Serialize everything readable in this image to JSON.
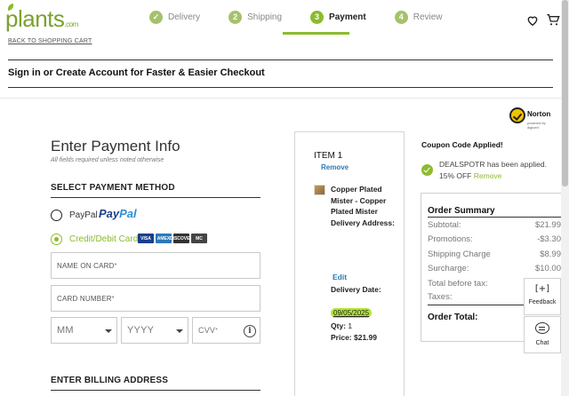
{
  "header": {
    "logo": "plants",
    "logo_suffix": ".com",
    "back_link": "BACK TO SHOPPING CART",
    "steps": [
      {
        "num": "✓",
        "label": "Delivery"
      },
      {
        "num": "2",
        "label": "Shipping"
      },
      {
        "num": "3",
        "label": "Payment"
      },
      {
        "num": "4",
        "label": "Review"
      }
    ],
    "active_step": "Payment",
    "icons": [
      "heart-icon",
      "cart-icon"
    ]
  },
  "signin_banner": "Sign in or Create Account for Faster & Easier Checkout",
  "norton": {
    "word": "Norton",
    "sub": "powered by digicert"
  },
  "payment": {
    "title": "Enter Payment Info",
    "note": "All fields required unless noted otherwise",
    "method_heading": "SELECT PAYMENT METHOD",
    "paypal_label": "PayPal",
    "paypal_logo_a": "Pay",
    "paypal_logo_b": "Pal",
    "card_label": "Credit/Debit Card",
    "card_logos": [
      {
        "name": "VISA",
        "color": "#1a3f8c"
      },
      {
        "name": "AMEX",
        "color": "#2e77bb"
      },
      {
        "name": "DISCOVER",
        "color": "#333333"
      },
      {
        "name": "MC",
        "color": "#444444"
      }
    ],
    "selected_method": "Credit/Debit Card",
    "name_placeholder": "NAME ON CARD",
    "number_placeholder": "CARD NUMBER",
    "month_placeholder": "MM",
    "year_placeholder": "YYYY",
    "cvv_placeholder": "CVV",
    "required_mark": "*",
    "billing_heading": "ENTER BILLING ADDRESS"
  },
  "item": {
    "title": "ITEM 1",
    "remove": "Remove",
    "name_lines": "Copper Plated Mister - Copper Plated Mister Delivery Address:",
    "edit": "Edit",
    "delivery_label": "Delivery Date:",
    "delivery_date": "09/05/2025",
    "qty_label": "Qty:",
    "qty_value": "1",
    "price": "Price: $21.99"
  },
  "coupon": {
    "title": "Coupon Code Applied!",
    "message": "DEALSPOTR has been applied. 15% OFF",
    "remove": "Remove"
  },
  "summary": {
    "title": "Order Summary",
    "rows": [
      {
        "label": "Subtotal:",
        "value": "$21.99"
      },
      {
        "label": "Promotions:",
        "value": "-$3.30"
      },
      {
        "label": "Shipping Charge",
        "value": "$8.99"
      },
      {
        "label": "Surcharge:",
        "value": "$10.00"
      },
      {
        "label": "Total before tax:",
        "value": ""
      },
      {
        "label": "Taxes:",
        "value": ""
      }
    ],
    "total_label": "Order Total:"
  },
  "widgets": {
    "feedback": "Feedback",
    "feedback_icon": "[+]",
    "chat": "Chat"
  },
  "colors": {
    "brand_green": "#8cbb2e",
    "link_blue": "#2a7ab8",
    "date_highlight": "#b4e43a"
  }
}
